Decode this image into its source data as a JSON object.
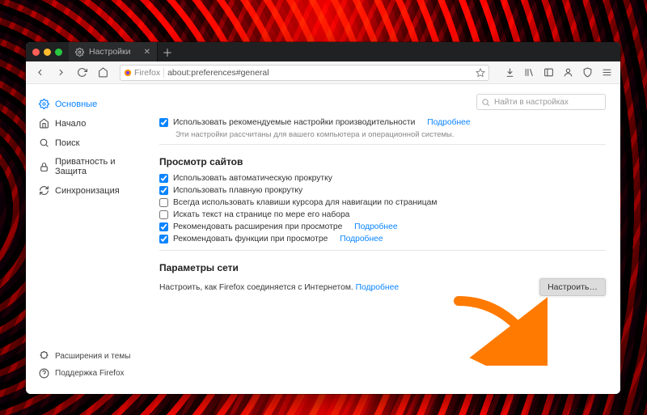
{
  "tab": {
    "title": "Настройки"
  },
  "url": {
    "badge": "Firefox",
    "address": "about:preferences#general"
  },
  "search": {
    "placeholder": "Найти в настройках"
  },
  "sidebar": {
    "items": [
      {
        "label": "Основные"
      },
      {
        "label": "Начало"
      },
      {
        "label": "Поиск"
      },
      {
        "label": "Приватность и Защита"
      },
      {
        "label": "Синхронизация"
      }
    ],
    "bottom": [
      {
        "label": "Расширения и темы"
      },
      {
        "label": "Поддержка Firefox"
      }
    ]
  },
  "performance": {
    "use_recommended": "Использовать рекомендуемые настройки производительности",
    "learn_more": "Подробнее",
    "note": "Эти настройки рассчитаны для вашего компьютера и операционной системы."
  },
  "browsing": {
    "title": "Просмотр сайтов",
    "autoscroll": "Использовать автоматическую прокрутку",
    "smooth": "Использовать плавную прокрутку",
    "cursor_keys": "Всегда использовать клавиши курсора для навигации по страницам",
    "search_typing": "Искать текст на странице по мере его набора",
    "rec_ext": "Рекомендовать расширения при просмотре",
    "rec_feat": "Рекомендовать функции при просмотре",
    "learn_more": "Подробнее"
  },
  "network": {
    "title": "Параметры сети",
    "desc": "Настроить, как Firefox соединяется с Интернетом.",
    "learn_more": "Подробнее",
    "button": "Настроить…"
  }
}
